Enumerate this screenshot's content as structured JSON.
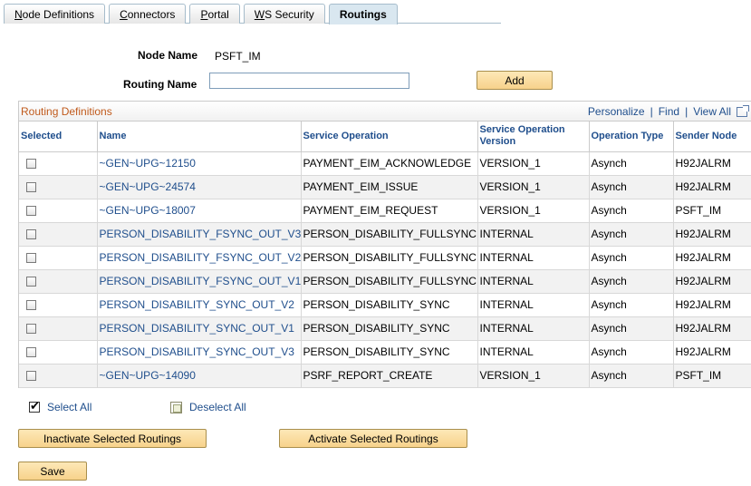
{
  "tabs": [
    {
      "label": "Node Definitions",
      "u": "N",
      "rest": "ode Definitions"
    },
    {
      "label": "Connectors",
      "u": "C",
      "rest": "onnectors"
    },
    {
      "label": "Portal",
      "u": "P",
      "rest": "ortal"
    },
    {
      "label": "WS Security",
      "u": "W",
      "rest": "S Security"
    },
    {
      "label": "Routings",
      "u": "",
      "rest": "Routings"
    }
  ],
  "form": {
    "node_name_label": "Node Name",
    "node_name_value": "PSFT_IM",
    "routing_name_label": "Routing Name",
    "routing_name_value": "",
    "add_label": "Add"
  },
  "grid": {
    "title": "Routing Definitions",
    "nav": {
      "personalize": "Personalize",
      "find": "Find",
      "view_all": "View All",
      "sep": "|"
    },
    "columns": [
      "Selected",
      "Name",
      "Service Operation",
      "Service Operation Version",
      "Operation Type",
      "Sender Node"
    ],
    "rows": [
      {
        "name": "~GEN~UPG~12150",
        "operation": "PAYMENT_EIM_ACKNOWLEDGE",
        "version": "VERSION_1",
        "type": "Asynch",
        "sender": "H92JALRM"
      },
      {
        "name": "~GEN~UPG~24574",
        "operation": "PAYMENT_EIM_ISSUE",
        "version": "VERSION_1",
        "type": "Asynch",
        "sender": "H92JALRM"
      },
      {
        "name": "~GEN~UPG~18007",
        "operation": "PAYMENT_EIM_REQUEST",
        "version": "VERSION_1",
        "type": "Asynch",
        "sender": "PSFT_IM"
      },
      {
        "name": "PERSON_DISABILITY_FSYNC_OUT_V3",
        "operation": "PERSON_DISABILITY_FULLSYNC",
        "version": "INTERNAL",
        "type": "Asynch",
        "sender": "H92JALRM"
      },
      {
        "name": "PERSON_DISABILITY_FSYNC_OUT_V2",
        "operation": "PERSON_DISABILITY_FULLSYNC",
        "version": "INTERNAL",
        "type": "Asynch",
        "sender": "H92JALRM"
      },
      {
        "name": "PERSON_DISABILITY_FSYNC_OUT_V1",
        "operation": "PERSON_DISABILITY_FULLSYNC",
        "version": "INTERNAL",
        "type": "Asynch",
        "sender": "H92JALRM"
      },
      {
        "name": "PERSON_DISABILITY_SYNC_OUT_V2",
        "operation": "PERSON_DISABILITY_SYNC",
        "version": "INTERNAL",
        "type": "Asynch",
        "sender": "H92JALRM"
      },
      {
        "name": "PERSON_DISABILITY_SYNC_OUT_V1",
        "operation": "PERSON_DISABILITY_SYNC",
        "version": "INTERNAL",
        "type": "Asynch",
        "sender": "H92JALRM"
      },
      {
        "name": "PERSON_DISABILITY_SYNC_OUT_V3",
        "operation": "PERSON_DISABILITY_SYNC",
        "version": "INTERNAL",
        "type": "Asynch",
        "sender": "H92JALRM"
      },
      {
        "name": "~GEN~UPG~14090",
        "operation": "PSRF_REPORT_CREATE",
        "version": "VERSION_1",
        "type": "Asynch",
        "sender": "PSFT_IM"
      }
    ]
  },
  "select_all_label": "Select All",
  "deselect_all_label": "Deselect All",
  "inactivate_label": "Inactivate Selected Routings",
  "activate_label": "Activate Selected Routings",
  "save_label": "Save",
  "colors": {
    "link": "#1f4e8c",
    "title": "#c05a1c",
    "button": "#f7d28b",
    "active_tab": "#d9e7f0"
  },
  "icons": {
    "select_all": "checkmark-icon",
    "deselect_all": "empty-box-icon",
    "view_all": "new-window-icon"
  }
}
